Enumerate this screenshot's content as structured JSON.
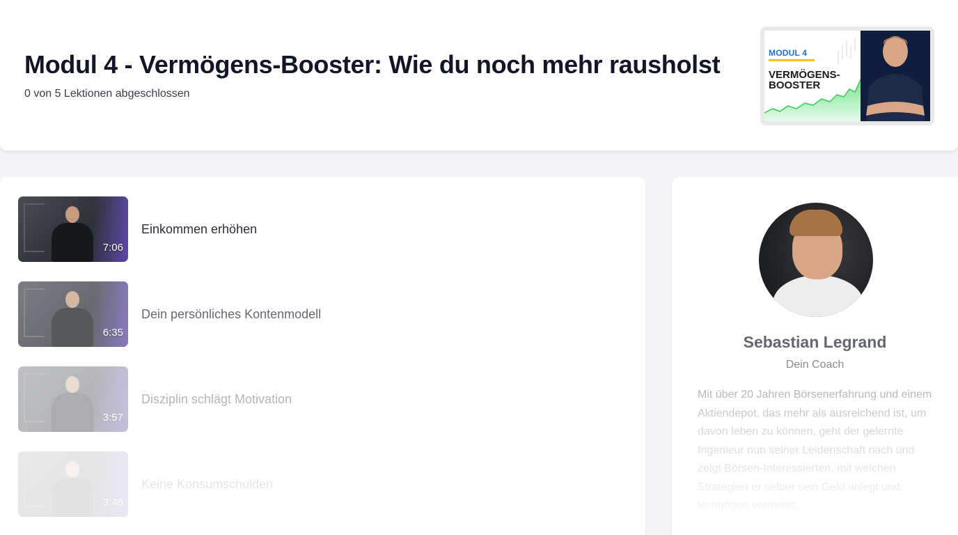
{
  "module": {
    "title": "Modul 4 - Vermögens-Booster: Wie du noch mehr rausholst",
    "progress_text": "0 von 5 Lektionen abgeschlossen",
    "thumbnail": {
      "label_small": "MODUL 4",
      "label_big": "VERMÖGENS-BOOSTER"
    }
  },
  "lessons": [
    {
      "title": "Einkommen erhöhen",
      "duration": "7:06"
    },
    {
      "title": "Dein persönliches Kontenmodell",
      "duration": "6:35"
    },
    {
      "title": "Disziplin schlägt Motivation",
      "duration": "3:57"
    },
    {
      "title": "Keine Konsumschulden",
      "duration": "3:46"
    }
  ],
  "coach": {
    "name": "Sebastian Legrand",
    "role": "Dein Coach",
    "bio": "Mit über 20 Jahren Börsenerfahrung und einem Aktiendepot, das mehr als ausreichend ist, um davon leben zu können, geht der gelernte Ingenieur nun seiner Leidenschaft nach und zeigt Börsen-Interessierten, mit welchen Strategien er selber sein Geld anlegt und Vermögen vermehrt."
  },
  "colors": {
    "background": "#f4f4f6",
    "card": "#ffffff",
    "title_text": "#141628",
    "thumb_accent_blue": "#1f6fd1",
    "thumb_accent_yellow": "#f3c316",
    "thumb_chart_green": "#5fe07a"
  }
}
